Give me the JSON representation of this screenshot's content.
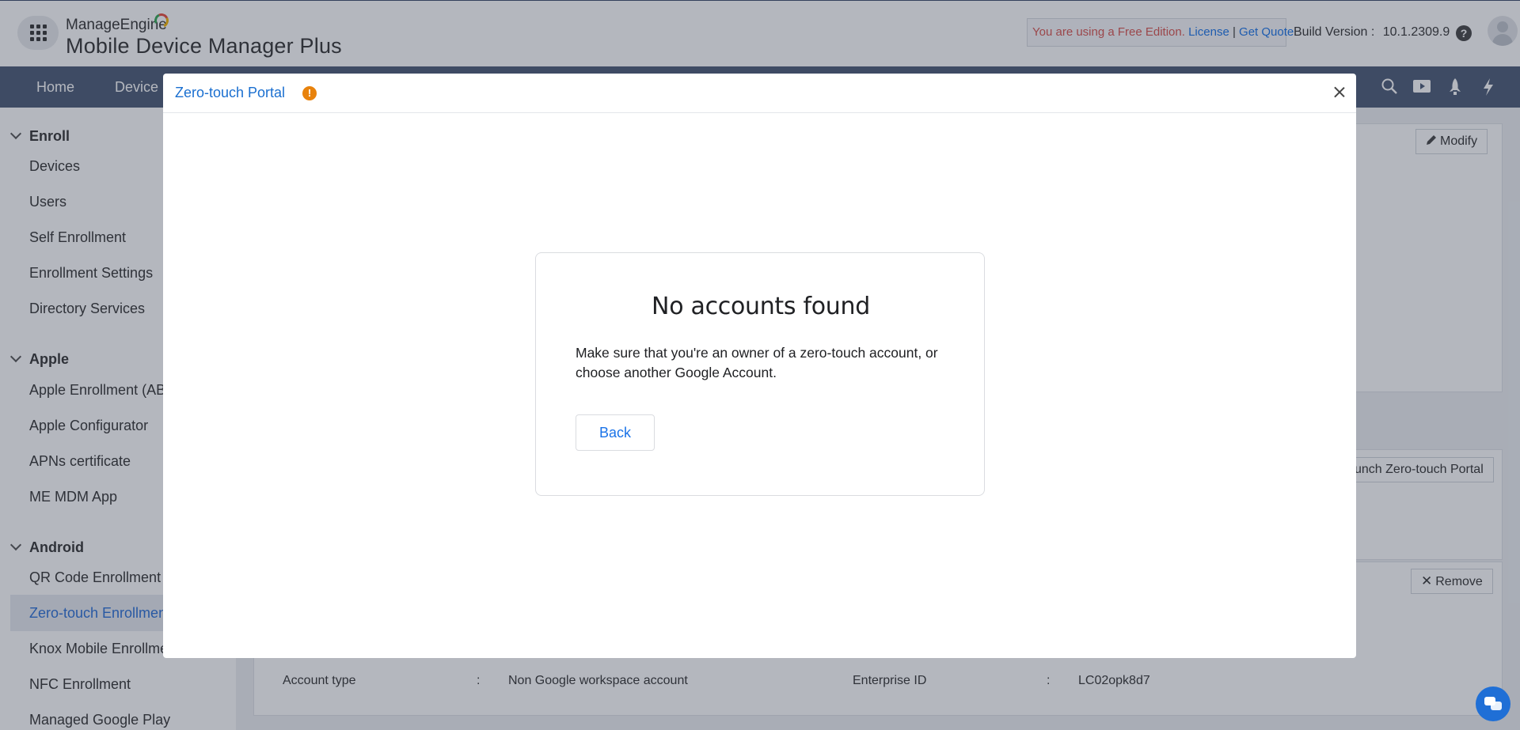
{
  "header": {
    "logo_small": "ManageEngine",
    "logo_big": "Mobile Device Manager Plus",
    "license_warning": "You are using a Free Edition.",
    "license_link": "License",
    "separator": "|",
    "quote_link": "Get Quote",
    "build_label": "Build Version :",
    "build_value": "10.1.2309.9"
  },
  "nav": {
    "items": [
      "Home",
      "Device M"
    ]
  },
  "sidebar": {
    "groups": [
      {
        "label": "Enroll",
        "items": [
          "Devices",
          "Users",
          "Self Enrollment",
          "Enrollment Settings",
          "Directory Services"
        ]
      },
      {
        "label": "Apple",
        "items": [
          "Apple Enrollment (ABM",
          "Apple Configurator",
          "APNs certificate",
          "ME MDM App"
        ]
      },
      {
        "label": "Android",
        "items": [
          "QR Code Enrollment",
          "Zero-touch Enrollmen",
          "Knox Mobile Enrollme",
          "NFC Enrollment",
          "Managed Google Play"
        ]
      }
    ],
    "active_item": "Zero-touch Enrollmen"
  },
  "content": {
    "modify_label": "Modify",
    "launch_label": "unch Zero-touch Portal",
    "remove_label": "Remove",
    "account_type_label": "Account type",
    "account_type_value": "Non Google workspace account",
    "enterprise_id_label": "Enterprise ID",
    "enterprise_id_value": "LC02opk8d7",
    "colon": ":"
  },
  "modal": {
    "title": "Zero-touch Portal",
    "warn_glyph": "!",
    "card_title": "No accounts found",
    "card_text": "Make sure that you're an owner of a zero-touch account, or choose another Google Account.",
    "back_label": "Back"
  },
  "colors": {
    "accent": "#1a73e8",
    "nav_bg": "#4a5a75",
    "warning": "#e8820c",
    "license_warning": "#d9534f"
  },
  "icons": [
    "app-grid-icon",
    "help-icon",
    "search-icon",
    "video-icon",
    "rocket-icon",
    "bolt-icon",
    "chevron-down-icon",
    "edit-icon",
    "close-icon",
    "warning-icon",
    "chat-icon"
  ]
}
